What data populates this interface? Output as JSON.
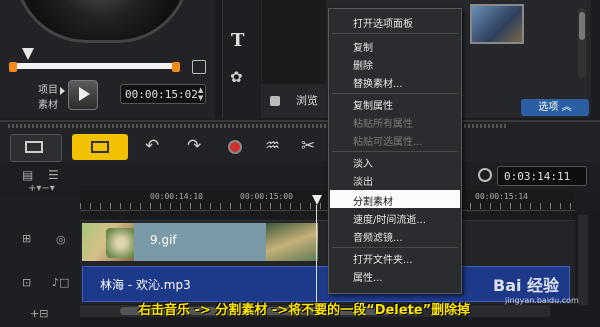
{
  "player": {
    "project_label": "项目",
    "clip_label": "素材",
    "timecode": "00:00:15:02"
  },
  "library": {
    "browse_label": "浏览",
    "options_label": "选项"
  },
  "timeline": {
    "timecode": "0:03:14:11",
    "ruler_labels": [
      "00:00:14:10",
      "00:00:15:00",
      "00:00:15:14"
    ],
    "video_clip_label": "9.gif",
    "audio_clip_label": "林海 - 欢沁.mp3"
  },
  "context_menu": {
    "items": [
      {
        "label": "打开选项面板",
        "enabled": true
      },
      {
        "label": "复制",
        "enabled": true
      },
      {
        "label": "删除",
        "enabled": true
      },
      {
        "label": "替换素材...",
        "enabled": true
      },
      {
        "label": "复制属性",
        "enabled": true
      },
      {
        "label": "粘贴所有属性",
        "enabled": false
      },
      {
        "label": "粘贴可选属性...",
        "enabled": false
      },
      {
        "label": "淡入",
        "enabled": true
      },
      {
        "label": "淡出",
        "enabled": true
      },
      {
        "label": "分割素材",
        "enabled": true,
        "highlighted": true
      },
      {
        "label": "速度/时间流逝...",
        "enabled": true
      },
      {
        "label": "音频滤镜...",
        "enabled": true
      },
      {
        "label": "打开文件夹...",
        "enabled": true
      },
      {
        "label": "属性...",
        "enabled": true
      }
    ]
  },
  "caption": "右击音乐 -> 分割素材 ->将不要的一段“Delete”删除掉",
  "watermark": {
    "text": "Bai 经验",
    "sub": "jingyan.baidu.com"
  },
  "colors": {
    "accent": "#f2c200",
    "audio_clip": "#1d3a8a",
    "video_clip": "#7b9aa7",
    "caption": "#ffe600",
    "trim_handle": "#f28a1a"
  }
}
